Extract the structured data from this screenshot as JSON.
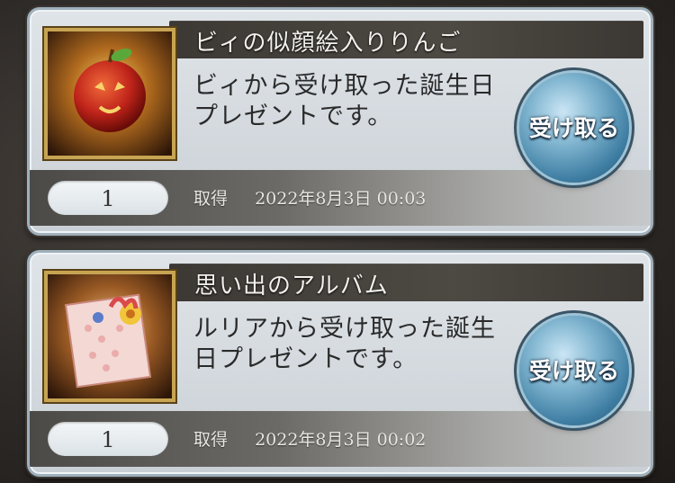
{
  "gifts": [
    {
      "title": "ビィの似顔絵入りりんご",
      "description": "ビィから受け取った誕生日プレゼントです。",
      "quantity": "1",
      "acquired_label": "取得",
      "acquired_date": "2022年8月3日 00:03",
      "button_label": "受け取る",
      "icon": "apple-icon"
    },
    {
      "title": "思い出のアルバム",
      "description": "ルリアから受け取った誕生日プレゼントです。",
      "quantity": "1",
      "acquired_label": "取得",
      "acquired_date": "2022年8月3日 00:02",
      "button_label": "受け取る",
      "icon": "album-icon"
    }
  ]
}
